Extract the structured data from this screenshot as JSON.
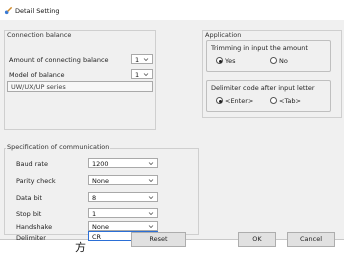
{
  "window": {
    "title": "Detail Setting"
  },
  "connection_balance": {
    "title": "Connection balance",
    "amount_label": "Amount of connecting balance",
    "amount_value": "1",
    "model_label": "Model of balance",
    "model_value": "1",
    "series_text": "UW/UX/UP series"
  },
  "communication": {
    "title": "Specification of communication",
    "rows": [
      {
        "label": "Baud rate",
        "value": "1200"
      },
      {
        "label": "Parity check",
        "value": "None"
      },
      {
        "label": "Data bit",
        "value": "8"
      },
      {
        "label": "Stop bit",
        "value": "1"
      },
      {
        "label": "Handshake",
        "value": "None"
      },
      {
        "label": "Delimiter",
        "value": "CR"
      }
    ]
  },
  "application": {
    "title": "Application",
    "trimming": {
      "title": "Trimming in input the amount",
      "options": [
        {
          "label": "Yes",
          "selected": true
        },
        {
          "label": "No",
          "selected": false
        }
      ]
    },
    "delimiter_code": {
      "title": "Delimiter code after input letter",
      "options": [
        {
          "label": "<Enter>",
          "selected": true
        },
        {
          "label": "<Tab>",
          "selected": false
        }
      ]
    }
  },
  "buttons": {
    "reset": "Reset",
    "ok": "OK",
    "cancel": "Cancel"
  },
  "stray_glyph": "方",
  "icons": {
    "title": "settings-icon",
    "dropdown": "chevron-down-icon"
  },
  "colors": {
    "window_bg": "#f0f0f0",
    "border": "#cfcfcf",
    "button_bg": "#e1e1e1"
  }
}
